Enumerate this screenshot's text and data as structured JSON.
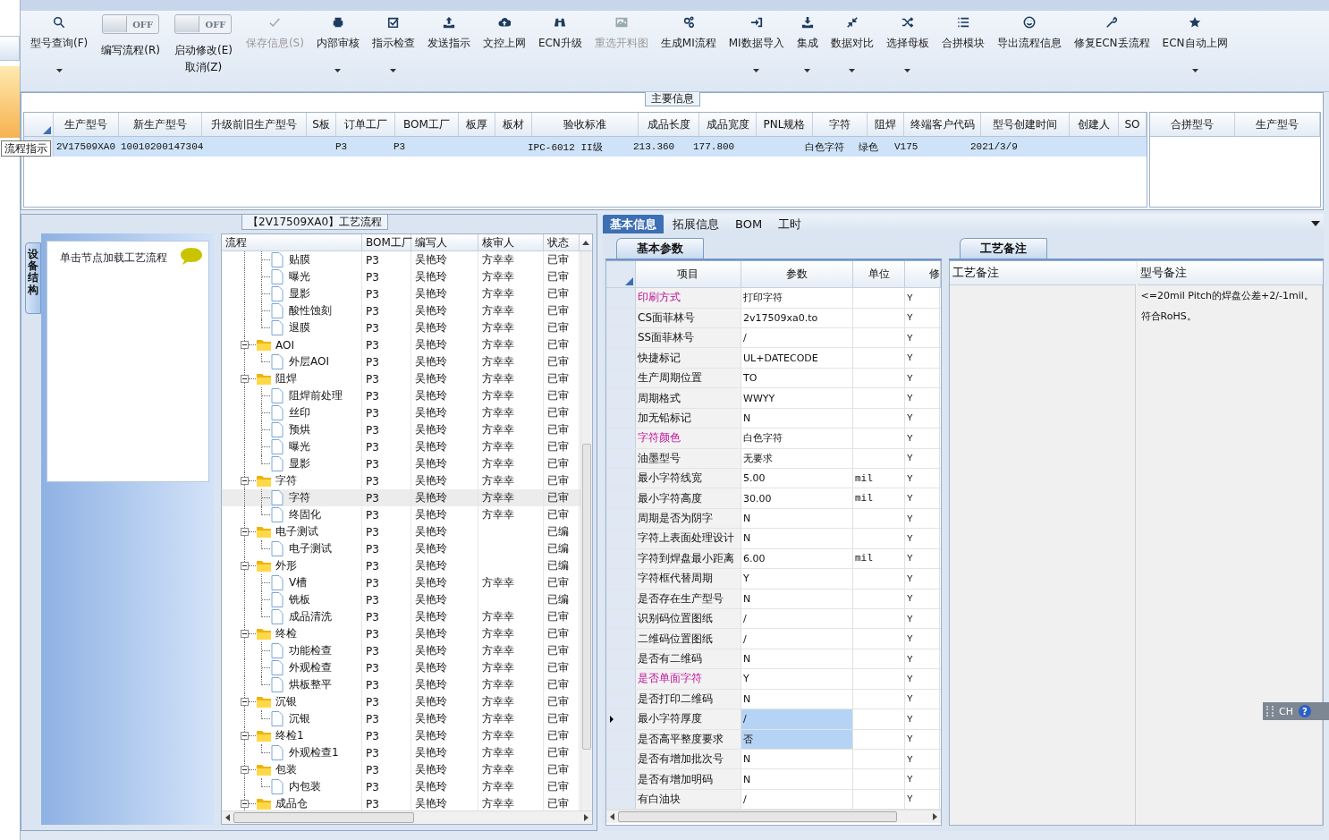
{
  "toolbar": [
    {
      "kind": "button",
      "label": "型号查询(F)",
      "disabled": false,
      "dropdown": true
    },
    {
      "kind": "toggle",
      "label": "编写流程(R)",
      "switch_text": "OFF",
      "on": false
    },
    {
      "kind": "toggle",
      "label": "启动修改(E)",
      "second_line": "取消(Z)",
      "switch_text": "OFF",
      "on": false
    },
    {
      "kind": "button",
      "label": "保存信息(S)",
      "disabled": true,
      "dropdown": false
    },
    {
      "kind": "button",
      "label": "内部审核",
      "disabled": false,
      "dropdown": true
    },
    {
      "kind": "button",
      "label": "指示检查",
      "disabled": false,
      "dropdown": true
    },
    {
      "kind": "button",
      "label": "发送指示",
      "disabled": false,
      "dropdown": false
    },
    {
      "kind": "button",
      "label": "文控上网",
      "disabled": false,
      "dropdown": false
    },
    {
      "kind": "button",
      "label": "ECN升级",
      "disabled": false,
      "dropdown": false
    },
    {
      "kind": "button",
      "label": "重选开料图",
      "disabled": true,
      "dropdown": false
    },
    {
      "kind": "button",
      "label": "生成MI流程",
      "disabled": false,
      "dropdown": false
    },
    {
      "kind": "button",
      "label": "MI数据导入",
      "disabled": false,
      "dropdown": true
    },
    {
      "kind": "button",
      "label": "集成",
      "disabled": false,
      "dropdown": true
    },
    {
      "kind": "button",
      "label": "数据对比",
      "disabled": false,
      "dropdown": true
    },
    {
      "kind": "button",
      "label": "选择母板",
      "disabled": false,
      "dropdown": true
    },
    {
      "kind": "button",
      "label": "合拼模块",
      "disabled": false,
      "dropdown": false
    },
    {
      "kind": "button",
      "label": "导出流程信息",
      "disabled": false,
      "dropdown": false
    },
    {
      "kind": "button",
      "label": "修复ECN丢流程",
      "disabled": false,
      "dropdown": false
    },
    {
      "kind": "button",
      "label": "ECN自动上网",
      "disabled": false,
      "dropdown": true
    }
  ],
  "tooltip": "流程指示",
  "main_info": {
    "title": "主要信息",
    "columns": [
      "生产型号",
      "新生产型号",
      "升级前旧生产型号",
      "S板",
      "订单工厂",
      "BOM工厂",
      "板厚",
      "板材",
      "验收标准",
      "成品长度",
      "成品宽度",
      "PNL规格",
      "字符",
      "阻焊",
      "终端客户代码",
      "型号创建时间",
      "创建人",
      "SO"
    ],
    "rows": [
      {
        "selected": true,
        "cells": [
          "2V17509XA0",
          "10010200147304",
          null,
          null,
          "P3",
          "P3",
          null,
          null,
          "IPC-6012 II级",
          "213.360",
          "177.800",
          null,
          "白色字符",
          "绿色",
          "V175",
          "2021/3/9",
          null,
          null
        ]
      }
    ],
    "side_columns": [
      "合拼型号",
      "生产型号"
    ]
  },
  "process_panel": {
    "title": "【2V17509XA0】工艺流程",
    "side_tab": "设备结构",
    "hint": "单击节点加载工艺流程",
    "columns": [
      "流程",
      "BOM工厂",
      "编写人",
      "核审人",
      "状态"
    ],
    "scrolled_children": [
      {
        "label": "贴膜",
        "bom": "P3",
        "writer": "吴艳玲",
        "reviewer": "方幸幸",
        "status": "已审",
        "selected": false
      },
      {
        "label": "曝光",
        "bom": "P3",
        "writer": "吴艳玲",
        "reviewer": "方幸幸",
        "status": "已审",
        "selected": false
      },
      {
        "label": "显影",
        "bom": "P3",
        "writer": "吴艳玲",
        "reviewer": "方幸幸",
        "status": "已审",
        "selected": false
      },
      {
        "label": "酸性蚀刻",
        "bom": "P3",
        "writer": "吴艳玲",
        "reviewer": "方幸幸",
        "status": "已审",
        "selected": false
      },
      {
        "label": "退膜",
        "bom": "P3",
        "writer": "吴艳玲",
        "reviewer": "方幸幸",
        "status": "已审",
        "selected": false
      }
    ],
    "nodes": [
      {
        "label": "AOI",
        "bom": "P3",
        "writer": "吴艳玲",
        "reviewer": "方幸幸",
        "status": "已审",
        "selected": false,
        "expanded": true,
        "children": [
          {
            "label": "外层AOI",
            "bom": "P3",
            "writer": "吴艳玲",
            "reviewer": "方幸幸",
            "status": "已审",
            "selected": false
          }
        ]
      },
      {
        "label": "阻焊",
        "bom": "P3",
        "writer": "吴艳玲",
        "reviewer": "方幸幸",
        "status": "已审",
        "selected": false,
        "expanded": true,
        "children": [
          {
            "label": "阻焊前处理",
            "bom": "P3",
            "writer": "吴艳玲",
            "reviewer": "方幸幸",
            "status": "已审",
            "selected": false
          },
          {
            "label": "丝印",
            "bom": "P3",
            "writer": "吴艳玲",
            "reviewer": "方幸幸",
            "status": "已审",
            "selected": false
          },
          {
            "label": "预烘",
            "bom": "P3",
            "writer": "吴艳玲",
            "reviewer": "方幸幸",
            "status": "已审",
            "selected": false
          },
          {
            "label": "曝光",
            "bom": "P3",
            "writer": "吴艳玲",
            "reviewer": "方幸幸",
            "status": "已审",
            "selected": false
          },
          {
            "label": "显影",
            "bom": "P3",
            "writer": "吴艳玲",
            "reviewer": "方幸幸",
            "status": "已审",
            "selected": false
          }
        ]
      },
      {
        "label": "字符",
        "bom": "P3",
        "writer": "吴艳玲",
        "reviewer": "方幸幸",
        "status": "已审",
        "selected": false,
        "expanded": true,
        "children": [
          {
            "label": "字符",
            "bom": "P3",
            "writer": "吴艳玲",
            "reviewer": "方幸幸",
            "status": "已审",
            "selected": true
          },
          {
            "label": "终固化",
            "bom": "P3",
            "writer": "吴艳玲",
            "reviewer": "方幸幸",
            "status": "已审",
            "selected": false
          }
        ]
      },
      {
        "label": "电子测试",
        "bom": "P3",
        "writer": "吴艳玲",
        "status": "已编",
        "selected": false,
        "expanded": true,
        "children": [
          {
            "label": "电子测试",
            "bom": "P3",
            "writer": "吴艳玲",
            "status": "已编",
            "selected": false
          }
        ]
      },
      {
        "label": "外形",
        "bom": "P3",
        "writer": "吴艳玲",
        "status": "已编",
        "selected": false,
        "expanded": true,
        "children": [
          {
            "label": "V槽",
            "bom": "P3",
            "writer": "吴艳玲",
            "reviewer": "方幸幸",
            "status": "已审",
            "selected": false
          },
          {
            "label": "铣板",
            "bom": "P3",
            "writer": "吴艳玲",
            "status": "已编",
            "selected": false
          },
          {
            "label": "成品清洗",
            "bom": "P3",
            "writer": "吴艳玲",
            "reviewer": "方幸幸",
            "status": "已审",
            "selected": false
          }
        ]
      },
      {
        "label": "终检",
        "bom": "P3",
        "writer": "吴艳玲",
        "reviewer": "方幸幸",
        "status": "已审",
        "selected": false,
        "expanded": true,
        "children": [
          {
            "label": "功能检查",
            "bom": "P3",
            "writer": "吴艳玲",
            "reviewer": "方幸幸",
            "status": "已审",
            "selected": false
          },
          {
            "label": "外观检查",
            "bom": "P3",
            "writer": "吴艳玲",
            "reviewer": "方幸幸",
            "status": "已审",
            "selected": false
          },
          {
            "label": "烘板整平",
            "bom": "P3",
            "writer": "吴艳玲",
            "reviewer": "方幸幸",
            "status": "已审",
            "selected": false
          }
        ]
      },
      {
        "label": "沉银",
        "bom": "P3",
        "writer": "吴艳玲",
        "reviewer": "方幸幸",
        "status": "已审",
        "selected": false,
        "expanded": true,
        "children": [
          {
            "label": "沉银",
            "bom": "P3",
            "writer": "吴艳玲",
            "reviewer": "方幸幸",
            "status": "已审",
            "selected": false
          }
        ]
      },
      {
        "label": "终检1",
        "bom": "P3",
        "writer": "吴艳玲",
        "reviewer": "方幸幸",
        "status": "已审",
        "selected": false,
        "expanded": true,
        "children": [
          {
            "label": "外观检查1",
            "bom": "P3",
            "writer": "吴艳玲",
            "reviewer": "方幸幸",
            "status": "已审",
            "selected": false
          }
        ]
      },
      {
        "label": "包装",
        "bom": "P3",
        "writer": "吴艳玲",
        "reviewer": "方幸幸",
        "status": "已审",
        "selected": false,
        "expanded": true,
        "children": [
          {
            "label": "内包装",
            "bom": "P3",
            "writer": "吴艳玲",
            "reviewer": "方幸幸",
            "status": "已审",
            "selected": false
          }
        ]
      },
      {
        "label": "成品仓",
        "bom": "P3",
        "writer": "吴艳玲",
        "reviewer": "方幸幸",
        "status": "已审",
        "selected": false,
        "expanded": true
      }
    ]
  },
  "detail_tabs": [
    {
      "label": "基本信息",
      "selected": true
    },
    {
      "label": "拓展信息",
      "selected": false
    },
    {
      "label": "BOM",
      "selected": false
    },
    {
      "label": "工时",
      "selected": false
    }
  ],
  "params": {
    "tab": "基本参数",
    "columns": [
      "项目",
      "参数",
      "单位",
      "修"
    ],
    "rows": [
      {
        "item": "印刷方式",
        "value": "打印字符",
        "unit": null,
        "changed": "Y",
        "flagged": true,
        "selected": false,
        "current": false
      },
      {
        "item": "CS面菲林号",
        "value": "2v17509xa0.to",
        "unit": null,
        "changed": "Y",
        "flagged": false,
        "selected": false,
        "current": false
      },
      {
        "item": "SS面菲林号",
        "value": "/",
        "unit": null,
        "changed": "Y",
        "flagged": false,
        "selected": false,
        "current": false
      },
      {
        "item": "快捷标记",
        "value": "UL+DATECODE",
        "unit": null,
        "changed": "Y",
        "flagged": false,
        "selected": false,
        "current": false
      },
      {
        "item": "生产周期位置",
        "value": "TO",
        "unit": null,
        "changed": "Y",
        "flagged": false,
        "selected": false,
        "current": false
      },
      {
        "item": "周期格式",
        "value": "WWYY",
        "unit": null,
        "changed": "Y",
        "flagged": false,
        "selected": false,
        "current": false
      },
      {
        "item": "加无铅标记",
        "value": "N",
        "unit": null,
        "changed": "Y",
        "flagged": false,
        "selected": false,
        "current": false
      },
      {
        "item": "字符颜色",
        "value": "白色字符",
        "unit": null,
        "changed": "Y",
        "flagged": true,
        "selected": false,
        "current": false
      },
      {
        "item": "油墨型号",
        "value": "无要求",
        "unit": null,
        "changed": "Y",
        "flagged": false,
        "selected": false,
        "current": false
      },
      {
        "item": "最小字符线宽",
        "value": "5.00",
        "unit": "mil",
        "changed": "Y",
        "flagged": false,
        "selected": false,
        "current": false
      },
      {
        "item": "最小字符高度",
        "value": "30.00",
        "unit": "mil",
        "changed": "Y",
        "flagged": false,
        "selected": false,
        "current": false
      },
      {
        "item": "周期是否为阴字",
        "value": "N",
        "unit": null,
        "changed": "Y",
        "flagged": false,
        "selected": false,
        "current": false
      },
      {
        "item": "字符上表面处理设计",
        "value": "N",
        "unit": null,
        "changed": "Y",
        "flagged": false,
        "selected": false,
        "current": false
      },
      {
        "item": "字符到焊盘最小距离",
        "value": "6.00",
        "unit": "mil",
        "changed": "Y",
        "flagged": false,
        "selected": false,
        "current": false
      },
      {
        "item": "字符框代替周期",
        "value": "Y",
        "unit": null,
        "changed": "Y",
        "flagged": false,
        "selected": false,
        "current": false
      },
      {
        "item": "是否存在生产型号",
        "value": "N",
        "unit": null,
        "changed": "Y",
        "flagged": false,
        "selected": false,
        "current": false
      },
      {
        "item": "识别码位置图纸",
        "value": "/",
        "unit": null,
        "changed": "Y",
        "flagged": false,
        "selected": false,
        "current": false
      },
      {
        "item": "二维码位置图纸",
        "value": "/",
        "unit": null,
        "changed": "Y",
        "flagged": false,
        "selected": false,
        "current": false
      },
      {
        "item": "是否有二维码",
        "value": "N",
        "unit": null,
        "changed": "Y",
        "flagged": false,
        "selected": false,
        "current": false
      },
      {
        "item": "是否单面字符",
        "value": "Y",
        "unit": null,
        "changed": "Y",
        "flagged": true,
        "selected": false,
        "current": false
      },
      {
        "item": "是否打印二维码",
        "value": "N",
        "unit": null,
        "changed": "Y",
        "flagged": false,
        "selected": false,
        "current": false
      },
      {
        "item": "最小字符厚度",
        "value": "/",
        "unit": null,
        "changed": "Y",
        "flagged": false,
        "selected": true,
        "current": true
      },
      {
        "item": "是否高平整度要求",
        "value": "否",
        "unit": null,
        "changed": "Y",
        "flagged": false,
        "selected": true,
        "current": false
      },
      {
        "item": "是否有增加批次号",
        "value": "N",
        "unit": null,
        "changed": "Y",
        "flagged": false,
        "selected": false,
        "current": false
      },
      {
        "item": "是否有增加明码",
        "value": "N",
        "unit": null,
        "changed": "Y",
        "flagged": false,
        "selected": false,
        "current": false
      },
      {
        "item": "有白油块",
        "value": "/",
        "unit": null,
        "changed": "Y",
        "flagged": false,
        "selected": false,
        "current": false
      }
    ]
  },
  "remarks": {
    "tab": "工艺备注",
    "columns": [
      "工艺备注",
      "型号备注"
    ],
    "model_remarks": [
      "<=20mil Pitch的焊盘公差+2/-1mil。",
      "符合RoHS。"
    ]
  },
  "ime_bar": {
    "language": "CH",
    "help": "?"
  }
}
